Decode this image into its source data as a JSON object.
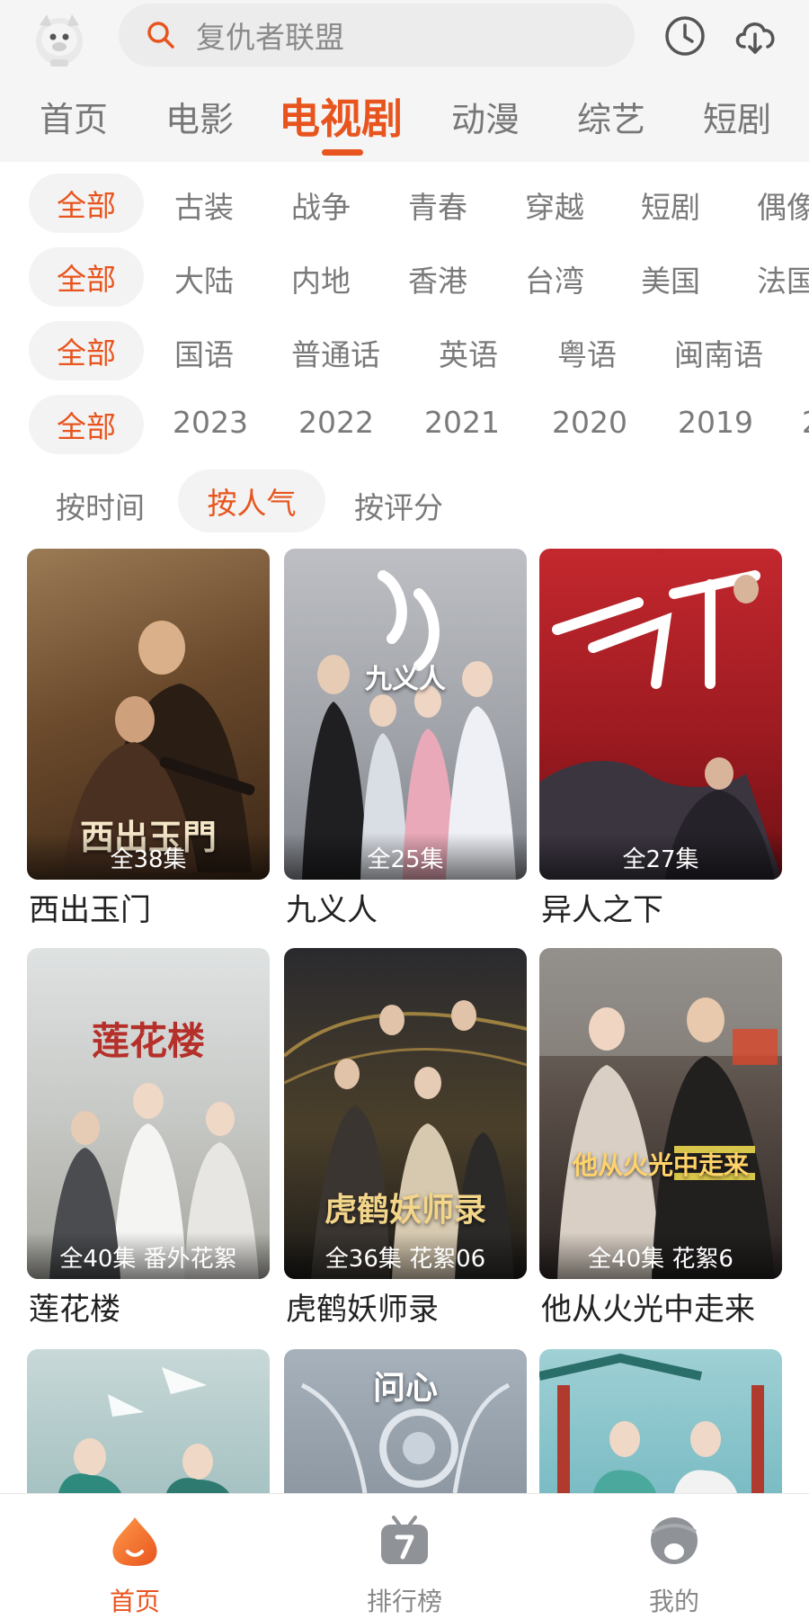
{
  "header": {
    "search_placeholder": "复仇者联盟"
  },
  "tabs": [
    {
      "label": "首页"
    },
    {
      "label": "电影"
    },
    {
      "label": "电视剧",
      "active": true
    },
    {
      "label": "动漫"
    },
    {
      "label": "综艺"
    },
    {
      "label": "短剧"
    }
  ],
  "filters": {
    "genre": [
      "全部",
      "古装",
      "战争",
      "青春",
      "穿越",
      "短剧",
      "偶像"
    ],
    "region": [
      "全部",
      "大陆",
      "内地",
      "香港",
      "台湾",
      "美国",
      "法国"
    ],
    "language": [
      "全部",
      "国语",
      "普通话",
      "英语",
      "粤语",
      "闽南语"
    ],
    "year": [
      "全部",
      "2023",
      "2022",
      "2021",
      "2020",
      "2019",
      "2"
    ]
  },
  "sort": [
    "按时间",
    "按人气",
    "按评分"
  ],
  "grid": [
    {
      "title": "西出玉门",
      "badge": "全38集",
      "art_text": "西出玉門"
    },
    {
      "title": "九义人",
      "badge": "全25集",
      "art_text": "九义人"
    },
    {
      "title": "异人之下",
      "badge": "全27集",
      "art_text": "之下"
    },
    {
      "title": "莲花楼",
      "badge": "全40集 番外花絮",
      "art_text": "莲花楼"
    },
    {
      "title": "虎鹤妖师录",
      "badge": "全36集 花絮06",
      "art_text": "虎鹤妖师录"
    },
    {
      "title": "他从火光中走来",
      "badge": "全40集 花絮6",
      "art_text": "他从火光中走来"
    },
    {
      "title": "",
      "badge": "",
      "art_text": ""
    },
    {
      "title": "",
      "badge": "",
      "art_text": "问心"
    },
    {
      "title": "",
      "badge": "",
      "art_text": ""
    }
  ],
  "bottom_nav": [
    {
      "label": "首页",
      "icon": "home-flame-icon",
      "active": true
    },
    {
      "label": "排行榜",
      "icon": "ranking-tv-icon"
    },
    {
      "label": "我的",
      "icon": "profile-icon"
    }
  ],
  "colors": {
    "accent": "#e8541e",
    "header_bg": "#f5f5f5",
    "inactive_text": "#7a7a7a"
  }
}
